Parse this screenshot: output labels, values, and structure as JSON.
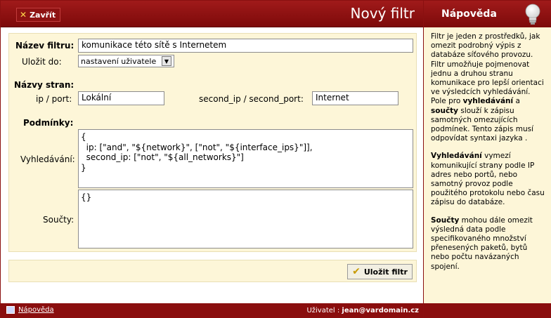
{
  "header": {
    "close_label": "Zavřít",
    "title": "Nový filtr"
  },
  "form": {
    "filter_name_label": "Název filtru:",
    "filter_name_value": "komunikace této sítě s Internetem",
    "save_to_label": "Uložit do:",
    "save_to_value": "nastavení uživatele",
    "sides_label": "Názvy stran:",
    "ip_port_label": "ip / port:",
    "ip_port_value": "Lokální",
    "second_label": "second_ip / second_port:",
    "second_value": "Internet",
    "conditions_label": "Podmínky:",
    "search_label": "Vyhledávání:",
    "search_value": "{\n  ip: [\"and\", \"${network}\", [\"not\", \"${interface_ips}\"]],\n  second_ip: [\"not\", \"${all_networks}\"]\n}",
    "sums_label": "Součty:",
    "sums_value": "{}"
  },
  "save_button": "Uložit filtr",
  "footer": {
    "help_link": "Nápověda",
    "user_label": "Uživatel :",
    "user_value": "jean@vardomain.cz"
  },
  "help": {
    "title": "Nápověda",
    "p1_a": "Filtr je jeden z prostředků, jak omezit podrobný výpis z databáze síťového provozu. Filtr umožňuje pojmenovat jednu a druhou stranu komunikace pro lepší orientaci ve výsledcích vyhledávání. Pole pro ",
    "p1_b": "vyhledávání",
    "p1_c": " a ",
    "p1_d": "součty",
    "p1_e": " slouží k zápisu samotných omezujících podmínek. Tento zápis musí odpovídat syntaxi jazyka .",
    "p2_a": "Vyhledávání",
    "p2_b": " vymezí komunikující strany podle IP adres nebo portů, nebo samotný provoz podle použitého protokolu nebo času zápisu do databáze.",
    "p3_a": "Součty",
    "p3_b": " mohou dále omezit výsledná data podle specifikovaného množství přenesených paketů, bytů nebo počtu navázaných spojení."
  }
}
